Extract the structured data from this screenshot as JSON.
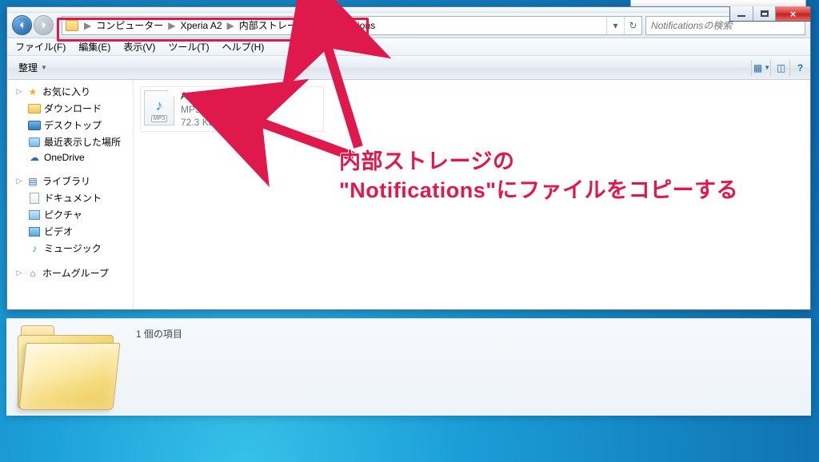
{
  "window_controls": {
    "min": "min",
    "max": "max",
    "close": "×"
  },
  "breadcrumb": {
    "items": [
      "コンピューター",
      "Xperia A2",
      "内部ストレージ",
      "Notifications"
    ],
    "sep": "▶"
  },
  "search": {
    "placeholder": "Notificationsの検索"
  },
  "menubar": {
    "file": "ファイル(F)",
    "edit": "編集(E)",
    "view": "表示(V)",
    "tool": "ツール(T)",
    "help": "ヘルプ(H)"
  },
  "toolbar": {
    "organize": "整理",
    "dd": "▼",
    "help": "?"
  },
  "sidebar": {
    "fav": "お気に入り",
    "downloads": "ダウンロード",
    "desktop": "デスクトップ",
    "recent": "最近表示した場所",
    "onedrive": "OneDrive",
    "libraries": "ライブラリ",
    "documents": "ドキュメント",
    "pictures": "ピクチャ",
    "videos": "ビデオ",
    "music": "ミュージック",
    "homegroup": "ホームグループ"
  },
  "file": {
    "name": "ANA_BELL.mp3",
    "kind": "MP3 形式サウンド",
    "size": "72.3 KB",
    "ext": "MP3",
    "note": "♪"
  },
  "details": {
    "count": "1 個の項目"
  },
  "annotation": {
    "line1": "内部ストレージの",
    "line2": "\"Notifications\"にファイルをコピーする"
  }
}
